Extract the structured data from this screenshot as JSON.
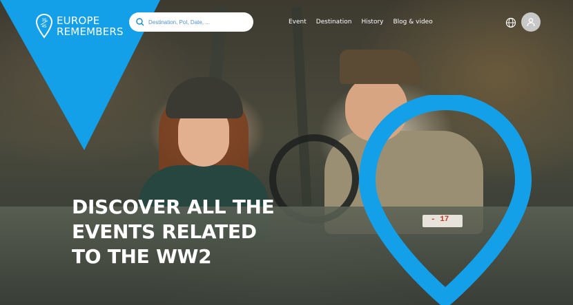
{
  "brand": {
    "logo_line1": "EUROPE",
    "logo_line2": "REMEMBERS",
    "logo_mark_top": "39",
    "logo_mark_bottom": "45",
    "color_blue": "#14a0e8"
  },
  "search": {
    "placeholder": "Destination, PoI, Date, ...",
    "icon": "search-icon"
  },
  "nav": {
    "items": [
      "Event",
      "Destination",
      "History",
      "Blog & video"
    ]
  },
  "header_icons": {
    "language": "globe-icon",
    "account": "user-icon"
  },
  "hero": {
    "headline_line1": "DISCOVER ALL THE",
    "headline_line2": "EVENTS RELATED",
    "headline_line3": "TO THE WW2",
    "plate_text": "- 17"
  }
}
